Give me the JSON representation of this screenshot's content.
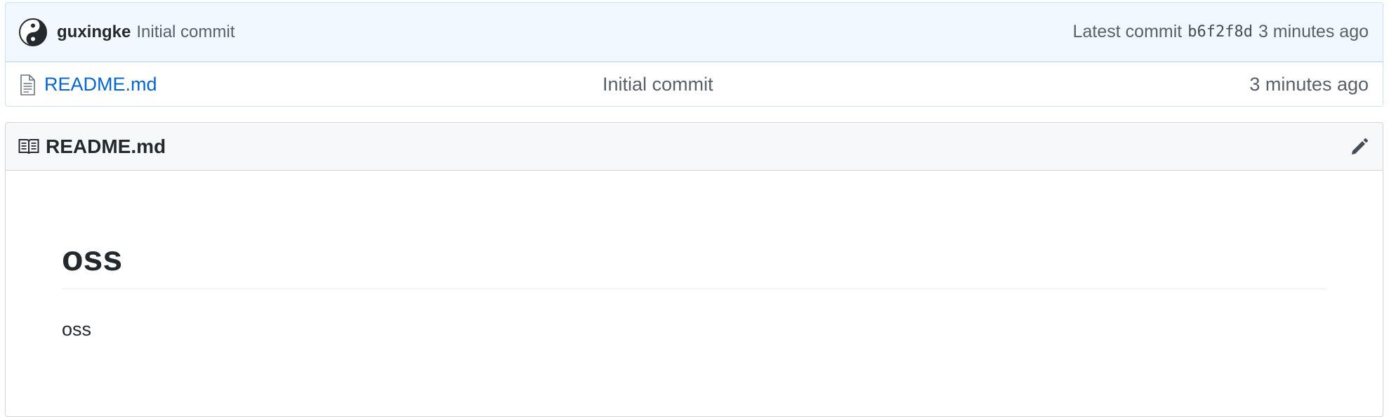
{
  "commit_bar": {
    "author": "guxingke",
    "message": "Initial commit",
    "latest_label": "Latest commit",
    "sha": "b6f2f8d",
    "age": "3 minutes ago",
    "avatar_icon": "yin-yang-avatar"
  },
  "files": [
    {
      "icon": "file-icon",
      "name": "README.md",
      "message": "Initial commit",
      "age": "3 minutes ago"
    }
  ],
  "readme": {
    "icon": "book-icon",
    "title": "README.md",
    "edit_icon": "pencil-icon",
    "heading": "oss",
    "paragraph": "oss"
  },
  "colors": {
    "commit_bar_bg": "#f1f8ff",
    "link": "#0366d6",
    "header_bg": "#f6f8fa",
    "muted_text": "#586069"
  }
}
